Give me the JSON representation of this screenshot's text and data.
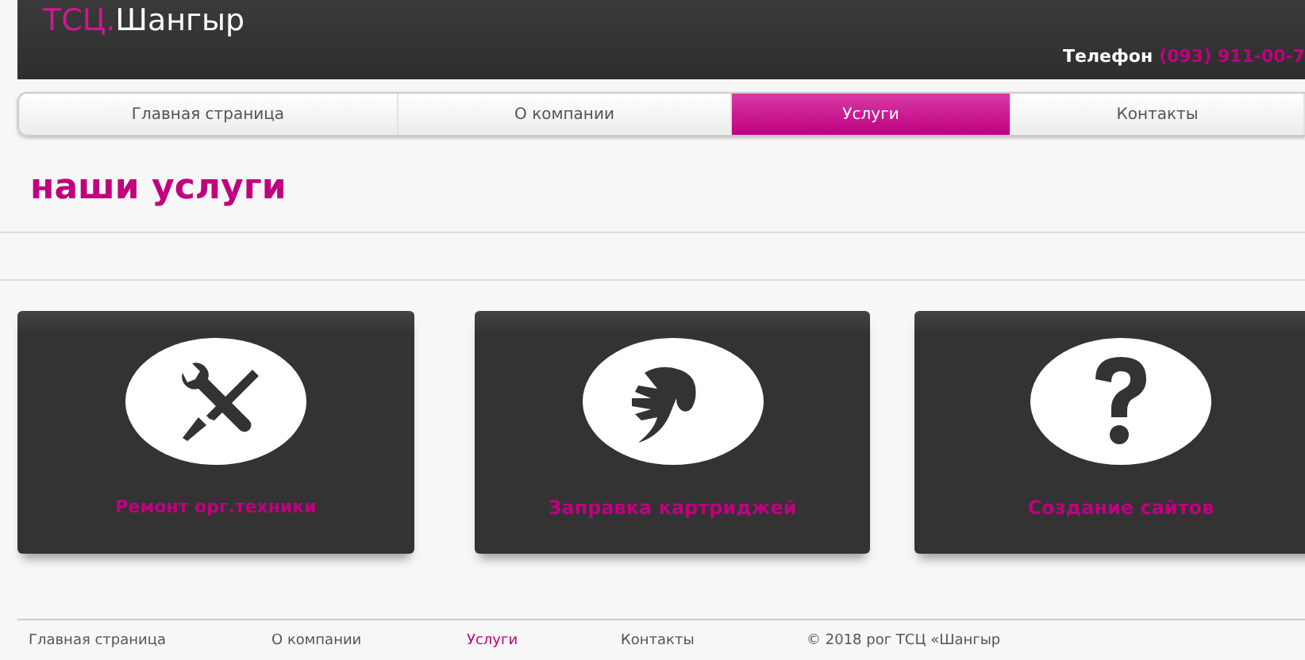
{
  "header": {
    "logo_accent": "ТСЦ.",
    "logo_text": "Шангыр",
    "phone_label": "Телефон",
    "phone": "(093) 911-00-7"
  },
  "nav": [
    {
      "label": "Главная страница",
      "selected": false
    },
    {
      "label": "О компании",
      "selected": false
    },
    {
      "label": "Услуги",
      "selected": true
    },
    {
      "label": "Контакты",
      "selected": false
    }
  ],
  "heading": "наши услуги",
  "services": [
    {
      "kind": "tools",
      "title": "Ремонт орг.техники"
    },
    {
      "kind": "hand",
      "title": "Заправка картриджей"
    },
    {
      "kind": "question",
      "title": "Создание сайтов"
    }
  ],
  "footer": {
    "links": [
      {
        "label": "Главная страница",
        "selected": false
      },
      {
        "label": "О компании",
        "selected": false
      },
      {
        "label": "Услуги",
        "selected": true
      },
      {
        "label": "Контакты",
        "selected": false
      }
    ],
    "copyright": "© 2018 рог ТСЦ «Шангыр"
  }
}
